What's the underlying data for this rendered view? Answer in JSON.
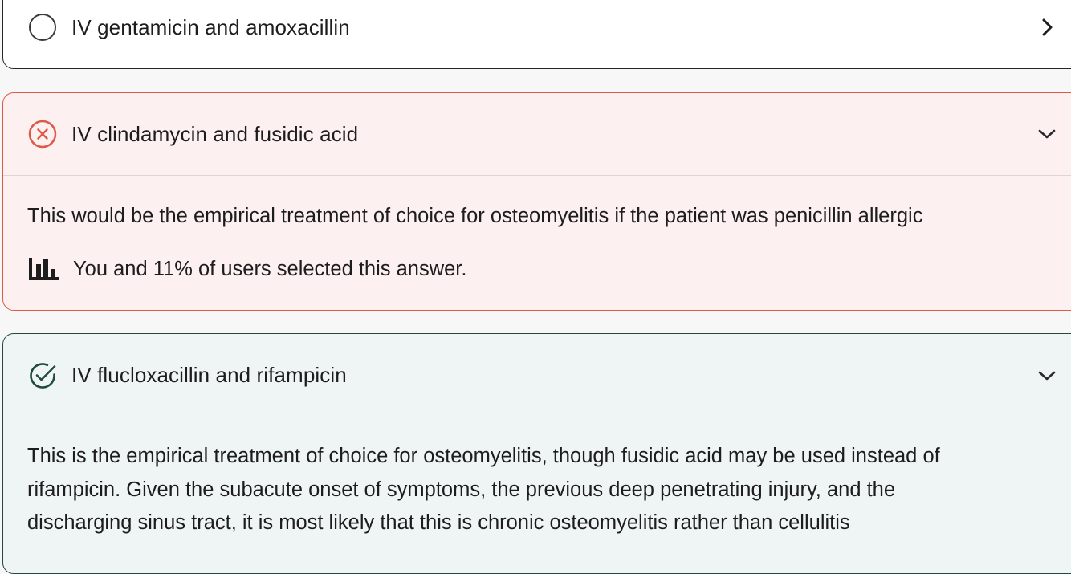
{
  "colors": {
    "incorrect_accent": "#de5a48",
    "incorrect_background": "#fdf0f0",
    "correct_accent": "#1f4a3e",
    "correct_background": "#eff5f4",
    "neutral_border": "#262626"
  },
  "options": [
    {
      "state": "unselected",
      "status_icon": "empty-circle-icon",
      "toggle_icon": "chevron-right-icon",
      "label": "IV gentamicin and amoxacillin"
    },
    {
      "state": "incorrect-selected",
      "status_icon": "x-circle-icon",
      "toggle_icon": "chevron-down-icon",
      "label": "IV clindamycin and fusidic acid",
      "explanation": "This would be the empirical treatment of choice for osteomyelitis if the patient was penicillin allergic",
      "stats_icon": "bar-chart-icon",
      "stats_text": "You and 11% of users selected this answer."
    },
    {
      "state": "correct",
      "status_icon": "check-circle-icon",
      "toggle_icon": "chevron-down-icon",
      "label": "IV flucloxacillin and rifampicin",
      "explanation_lines": [
        "This is the empirical treatment of choice for osteomyelitis, though fusidic acid may be used instead of",
        "rifampicin. Given the subacute onset of symptoms, the previous deep penetrating injury, and the",
        "discharging sinus tract, it is most likely that this is chronic osteomyelitis rather than cellulitis"
      ]
    }
  ]
}
